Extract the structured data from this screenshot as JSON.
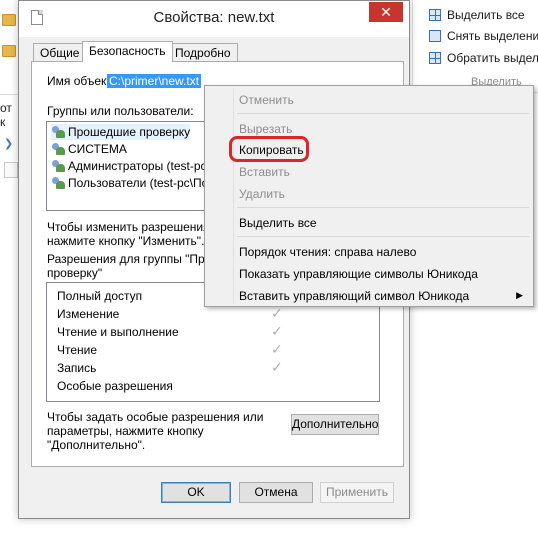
{
  "background": {
    "left_text": "от к",
    "ribbon": {
      "items": [
        "Выделить все",
        "Снять выделение",
        "Обратить выделе"
      ],
      "group_label": "Выделить"
    }
  },
  "dialog": {
    "title": "Свойства: new.txt",
    "close_glyph": "✕",
    "tabs": [
      {
        "label": "Общие",
        "active": false
      },
      {
        "label": "Безопасность",
        "active": true
      },
      {
        "label": "Подробно",
        "active": false
      }
    ],
    "object_name_label": "Имя объекта:",
    "object_name_value": "C:\\primer\\new.txt",
    "groups_label": "Группы или пользователи:",
    "users": [
      "Прошедшие проверку",
      "СИСТЕМА",
      "Администраторы (test-pc\\А",
      "Пользователи (test-pc\\Пол"
    ],
    "change_hint_line1": "Чтобы изменить разрешения,",
    "change_hint_line2": "нажмите кнопку \"Изменить\".",
    "perm_for_line1": "Разрешения для группы \"Прош",
    "perm_for_line2": "проверку\"",
    "permissions": [
      {
        "name": "Полный доступ",
        "checked": false
      },
      {
        "name": "Изменение",
        "checked": true
      },
      {
        "name": "Чтение и выполнение",
        "checked": true
      },
      {
        "name": "Чтение",
        "checked": true
      },
      {
        "name": "Запись",
        "checked": true
      },
      {
        "name": "Особые разрешения",
        "checked": false
      }
    ],
    "special_hint_line1": "Чтобы задать особые разрешения или",
    "special_hint_line2": "параметры, нажмите кнопку",
    "special_hint_line3": "\"Дополнительно\".",
    "advanced_button": "Дополнительно",
    "ok_button": "OK",
    "cancel_button": "Отмена",
    "apply_button": "Применить"
  },
  "context_menu": {
    "items": [
      {
        "label": "Отменить",
        "disabled": true
      },
      {
        "label": "Вырезать",
        "disabled": true
      },
      {
        "label": "Копировать",
        "disabled": false
      },
      {
        "label": "Вставить",
        "disabled": true
      },
      {
        "label": "Удалить",
        "disabled": true
      },
      {
        "label": "Выделить все",
        "disabled": false
      },
      {
        "label": "Порядок чтения: справа налево",
        "disabled": false
      },
      {
        "label": "Показать управляющие символы Юникода",
        "disabled": false
      },
      {
        "label": "Вставить управляющий символ Юникода",
        "disabled": false
      }
    ],
    "submenu_arrow": "▶",
    "highlight_color": "#d8262a"
  },
  "colors": {
    "selection": "#3399ff",
    "close_button": "#c7362e",
    "accent_blue": "#3c7fb1"
  }
}
